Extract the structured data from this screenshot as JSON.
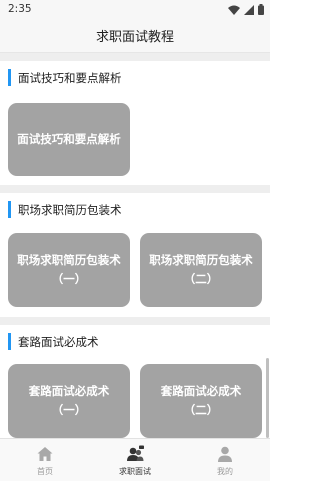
{
  "status_bar": {
    "time": "2:35"
  },
  "header": {
    "title": "求职面试教程"
  },
  "sections": [
    {
      "title": "面试技巧和要点解析",
      "cards": [
        {
          "label": "面试技巧和要点解析"
        }
      ]
    },
    {
      "title": "职场求职简历包装术",
      "cards": [
        {
          "label": "职场求职简历包装术（一）"
        },
        {
          "label": "职场求职简历包装术（二）"
        }
      ]
    },
    {
      "title": "套路面试必成术",
      "cards": [
        {
          "label": "套路面试必成术（一）"
        },
        {
          "label": "套路面试必成术（二）"
        }
      ]
    }
  ],
  "tabs": [
    {
      "label": "首页",
      "icon": "home-icon"
    },
    {
      "label": "求职面试",
      "icon": "people-icon",
      "active": true
    },
    {
      "label": "我的",
      "icon": "person-icon"
    }
  ],
  "colors": {
    "accent": "#2196f3",
    "card": "#a3a3a3",
    "divider": "#eeeeee"
  }
}
